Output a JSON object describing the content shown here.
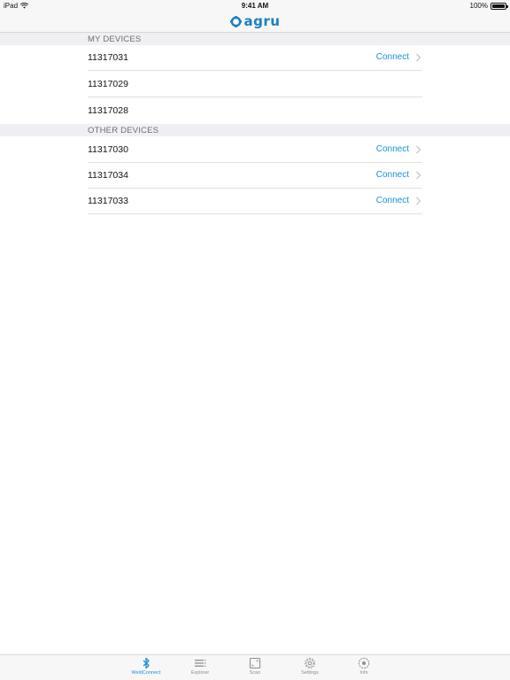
{
  "status_bar": {
    "device": "iPad",
    "time": "9:41 AM",
    "battery": "100%"
  },
  "nav": {
    "logo_text": "agru",
    "logo_icon": "agru-logo-icon"
  },
  "sections": {
    "my_devices": {
      "title": "MY DEVICES",
      "items": [
        {
          "label": "11317031",
          "action": "Connect"
        },
        {
          "label": "11317029",
          "action": ""
        },
        {
          "label": "11317028",
          "action": ""
        }
      ]
    },
    "other_devices": {
      "title": "OTHER DEVICES",
      "items": [
        {
          "label": "11317030",
          "action": "Connect"
        },
        {
          "label": "11317034",
          "action": "Connect"
        },
        {
          "label": "11317033",
          "action": "Connect"
        }
      ]
    }
  },
  "tab_bar": {
    "tabs": [
      {
        "label": "WeldConnect",
        "icon": "bluetooth-icon",
        "active": true
      },
      {
        "label": "Explorer",
        "icon": "list-icon",
        "active": false
      },
      {
        "label": "Scan",
        "icon": "scan-icon",
        "active": false
      },
      {
        "label": "Settings",
        "icon": "gear-icon",
        "active": false
      },
      {
        "label": "Info",
        "icon": "info-icon",
        "active": false
      }
    ]
  },
  "colors": {
    "accent": "#1a8fd6",
    "logo": "#1a7fc4",
    "section_bg": "#efeff4",
    "inactive_tab": "#8e8e93"
  }
}
